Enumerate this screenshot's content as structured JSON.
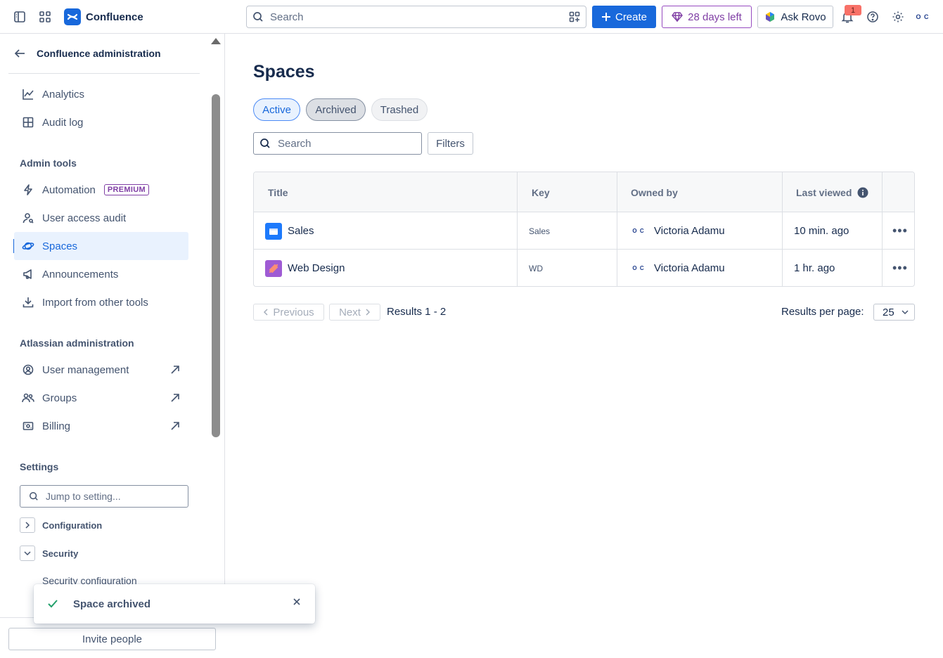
{
  "topbar": {
    "app_name": "Confluence",
    "search_placeholder": "Search",
    "create_label": "Create",
    "trial_label": "28 days left",
    "rovo_label": "Ask Rovo",
    "notification_count": "1",
    "avatar_initials": "O C"
  },
  "sidebar": {
    "header_title": "Confluence administration",
    "top_items": [
      {
        "label": "Analytics",
        "icon": "chart-line-icon"
      },
      {
        "label": "Audit log",
        "icon": "table-icon"
      }
    ],
    "admin_tools_title": "Admin tools",
    "admin_items": [
      {
        "label": "Automation",
        "icon": "lightning-icon",
        "badge": "PREMIUM"
      },
      {
        "label": "User access audit",
        "icon": "person-search-icon"
      },
      {
        "label": "Spaces",
        "icon": "planet-icon",
        "active": true
      },
      {
        "label": "Announcements",
        "icon": "megaphone-icon"
      },
      {
        "label": "Import from other tools",
        "icon": "download-icon"
      }
    ],
    "atlassian_admin_title": "Atlassian administration",
    "atlassian_items": [
      {
        "label": "User management",
        "icon": "person-circle-icon"
      },
      {
        "label": "Groups",
        "icon": "people-icon"
      },
      {
        "label": "Billing",
        "icon": "billing-icon"
      }
    ],
    "settings_title": "Settings",
    "jump_placeholder": "Jump to setting...",
    "tree": [
      {
        "label": "Configuration",
        "expanded": false
      },
      {
        "label": "Security",
        "expanded": true
      }
    ],
    "sub_item": "Security configuration",
    "invite_label": "Invite people"
  },
  "toast": {
    "message": "Space archived"
  },
  "main": {
    "title": "Spaces",
    "tabs": [
      "Active",
      "Archived",
      "Trashed"
    ],
    "search_placeholder": "Search",
    "filters_label": "Filters",
    "columns": [
      "Title",
      "Key",
      "Owned by",
      "Last viewed"
    ],
    "rows": [
      {
        "title": "Sales",
        "key": "Sales",
        "owner": "Victoria Adamu",
        "last_viewed": "10 min. ago",
        "icon_color": "#1d7afc"
      },
      {
        "title": "Web Design",
        "key": "WD",
        "owner": "Victoria Adamu",
        "last_viewed": "1 hr. ago",
        "icon_color": "#9f5bd4"
      }
    ],
    "previous_label": "Previous",
    "next_label": "Next",
    "results_text": "Results 1 - 2",
    "rpp_label": "Results per page:",
    "rpp_value": "25"
  },
  "colors": {
    "brand": "#1868db",
    "trial": "#803fa5",
    "success": "#22a06b"
  }
}
